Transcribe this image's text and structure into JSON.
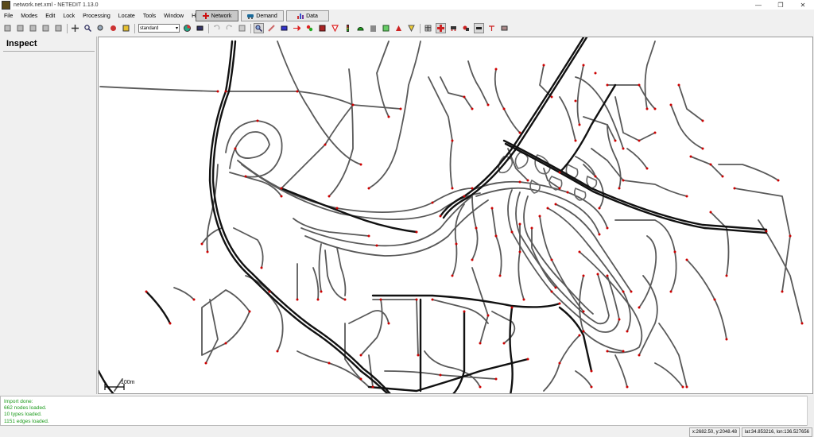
{
  "window": {
    "title": "network.net.xml - NETEDIT 1.13.0"
  },
  "window_controls": {
    "minimize": "—",
    "maximize": "❐",
    "close": "✕"
  },
  "menu": [
    {
      "label": "File",
      "key": "F"
    },
    {
      "label": "Modes",
      "key": "M"
    },
    {
      "label": "Edit",
      "key": "E"
    },
    {
      "label": "Lock",
      "key": "L"
    },
    {
      "label": "Processing",
      "key": "P"
    },
    {
      "label": "Locate",
      "key": "L"
    },
    {
      "label": "Tools",
      "key": "T"
    },
    {
      "label": "Window",
      "key": "W"
    },
    {
      "label": "Help",
      "key": "H"
    }
  ],
  "mode_tabs": [
    {
      "label": "Network",
      "icon": "network-icon",
      "active": true,
      "color": "#cc1111"
    },
    {
      "label": "Demand",
      "icon": "demand-icon",
      "active": false,
      "color": "#1a6a9a"
    },
    {
      "label": "Data",
      "icon": "data-icon",
      "active": false,
      "color": "#7a3a9a"
    }
  ],
  "toolbar": {
    "scheme_select": "standard",
    "dropdown_arrow": "▾"
  },
  "side_panel": {
    "title": "Inspect"
  },
  "canvas": {
    "scale_label": "100m"
  },
  "console": {
    "lines": [
      "Import done:",
      "  662 nodes loaded.",
      "  10 types loaded.",
      "  1151 edges loaded."
    ]
  },
  "status": {
    "position": "x:2682.50, y:2048.48",
    "geo": "lat:34.853216, lon:136.527656"
  },
  "colors": {
    "road": "#555555",
    "highway": "#111111",
    "junction": "#cc0000",
    "console_text": "#1a9a1a"
  }
}
